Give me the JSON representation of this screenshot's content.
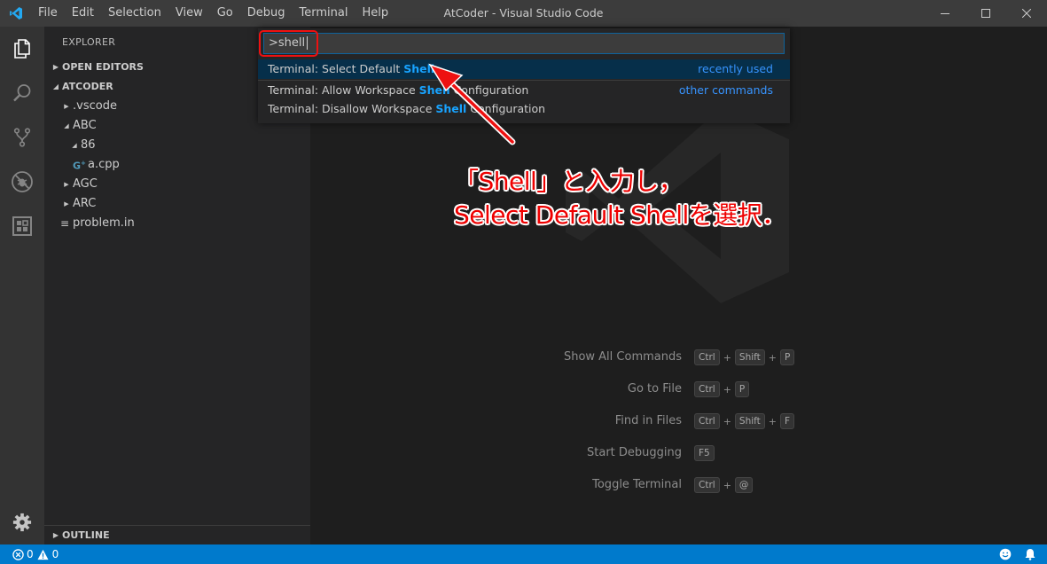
{
  "window": {
    "title": "AtCoder - Visual Studio Code"
  },
  "menu": [
    "File",
    "Edit",
    "Selection",
    "View",
    "Go",
    "Debug",
    "Terminal",
    "Help"
  ],
  "activity_bar": [
    "files-icon",
    "search-icon",
    "source-control-icon",
    "debug-icon",
    "extensions-icon",
    "gear-icon"
  ],
  "sidebar": {
    "title": "EXPLORER",
    "sections": {
      "open_editors": "OPEN EDITORS",
      "folder": "ATCODER",
      "outline": "OUTLINE"
    },
    "tree": [
      ".vscode",
      "ABC",
      "86",
      "a.cpp",
      "AGC",
      "ARC",
      "problem.in"
    ],
    "cpp_badge": "G"
  },
  "quick_open": {
    "input_value": ">shell",
    "items": [
      {
        "prefix": "Terminal: Select Default ",
        "match": "Shell",
        "suffix": "",
        "tag": "recently used"
      },
      {
        "prefix": "Terminal: Allow Workspace ",
        "match": "Shell",
        "suffix": " Configuration",
        "tag": "other commands"
      },
      {
        "prefix": "Terminal: Disallow Workspace ",
        "match": "Shell",
        "suffix": " Configuration",
        "tag": ""
      }
    ]
  },
  "shortcuts": [
    {
      "label": "Show All Commands",
      "keys": [
        "Ctrl",
        "Shift",
        "P"
      ]
    },
    {
      "label": "Go to File",
      "keys": [
        "Ctrl",
        "P"
      ]
    },
    {
      "label": "Find in Files",
      "keys": [
        "Ctrl",
        "Shift",
        "F"
      ]
    },
    {
      "label": "Start Debugging",
      "keys": [
        "F5"
      ]
    },
    {
      "label": "Toggle Terminal",
      "keys": [
        "Ctrl",
        "@"
      ]
    }
  ],
  "annotation": {
    "line1": "「Shell」と入力し，",
    "line2": "Select Default Shellを選択．"
  },
  "status": {
    "errors": "0",
    "warnings": "0"
  },
  "colors": {
    "status_bar": "#007acc",
    "highlight": "#18a3ff",
    "annotation": "#ee0000"
  }
}
